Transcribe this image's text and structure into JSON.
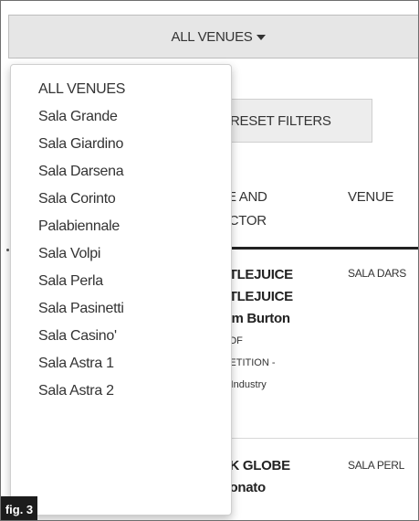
{
  "venues_bar": {
    "label": "ALL VENUES"
  },
  "reset_button": {
    "label": "RESET FILTERS"
  },
  "table": {
    "headers": {
      "title_director": "LE AND\nECTOR",
      "venue": "VENUE"
    },
    "rows": [
      {
        "title1": "ETLEJUICE",
        "title2": "ETLEJUICE",
        "director": "Tim Burton",
        "section1": "T OF",
        "section2": "IPETITION -",
        "section3": "s, Industry",
        "venue": "SALA DARS"
      },
      {
        "title1": "RK GLOBE",
        "director": "Donato",
        "venue": "SALA PERL"
      }
    ]
  },
  "dropdown": {
    "items": [
      "ALL VENUES",
      "Sala Grande",
      "Sala Giardino",
      "Sala Darsena",
      "Sala Corinto",
      "Palabiennale",
      "Sala Volpi",
      "Sala Perla",
      "Sala Pasinetti",
      "Sala Casino'",
      "Sala Astra 1",
      "Sala Astra 2"
    ]
  },
  "figure_label": "fig. 3",
  "colors": {
    "bar_bg": "#e6e6e6",
    "button_bg": "#ededed",
    "text": "#333333",
    "label_bg": "#1c1c1c"
  }
}
